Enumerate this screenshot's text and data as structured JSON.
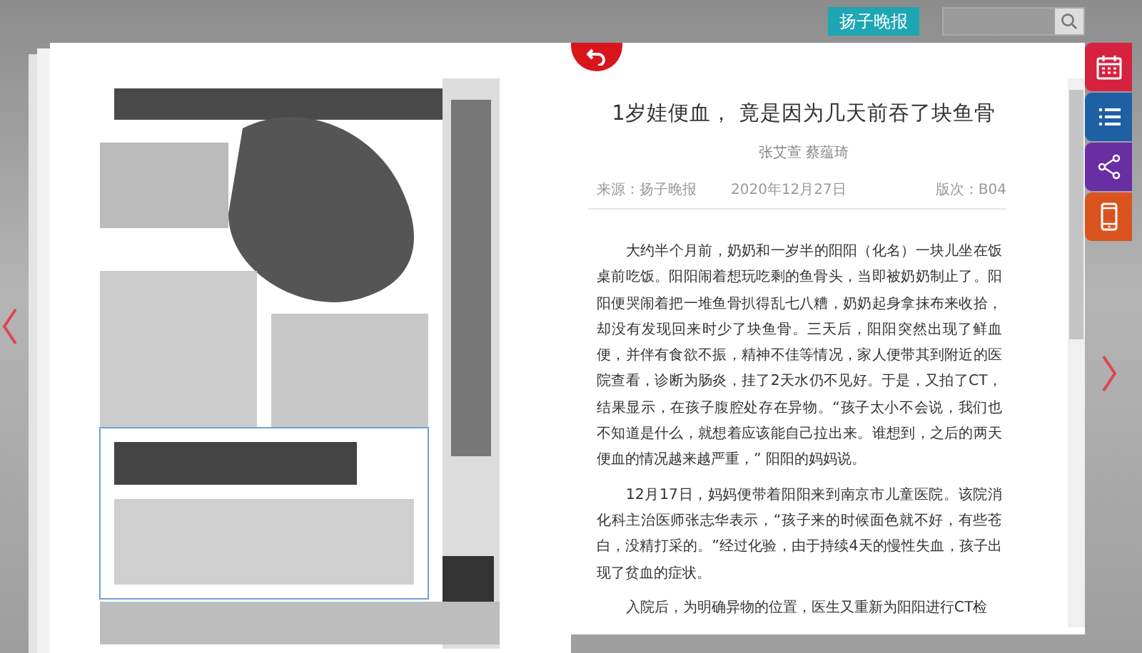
{
  "top_bar": {
    "paper_button": "扬子晚报"
  },
  "article": {
    "title": "1岁娃便血， 竟是因为几天前吞了块鱼骨",
    "authors": "张艾萱 蔡蕴琦",
    "source": "来源：扬子晚报",
    "date": "2020年12月27日",
    "edition": "版次：B04",
    "paragraphs": [
      "大约半个月前，奶奶和一岁半的阳阳（化名）一块儿坐在饭桌前吃饭。阳阳闹着想玩吃剩的鱼骨头，当即被奶奶制止了。阳阳便哭闹着把一堆鱼骨扒得乱七八糟，奶奶起身拿抹布来收拾，却没有发现回来时少了块鱼骨。三天后，阳阳突然出现了鲜血便，并伴有食欲不振，精神不佳等情况，家人便带其到附近的医院查看，诊断为肠炎，挂了2天水仍不见好。于是，又拍了CT，结果显示，在孩子腹腔处存在异物。“孩子太小不会说，我们也不知道是什么，就想着应该能自己拉出来。谁想到，之后的两天便血的情况越来越严重，” 阳阳的妈妈说。",
      "12月17日，妈妈便带着阳阳来到南京市儿童医院。该院消化科主治医师张志华表示，“孩子来的时候面色就不好，有些苍白，没精打采的。”经过化验，由于持续4天的慢性失血，孩子出现了贫血的症状。",
      "入院后，为明确异物的位置，医生又重新为阳阳进行CT检"
    ]
  },
  "side_tabs": [
    {
      "kind": "calendar",
      "color": "#d6213f"
    },
    {
      "kind": "list",
      "color": "#1f5fa3"
    },
    {
      "kind": "share",
      "color": "#6a2ea3"
    },
    {
      "kind": "phone",
      "color": "#d9531e"
    }
  ]
}
